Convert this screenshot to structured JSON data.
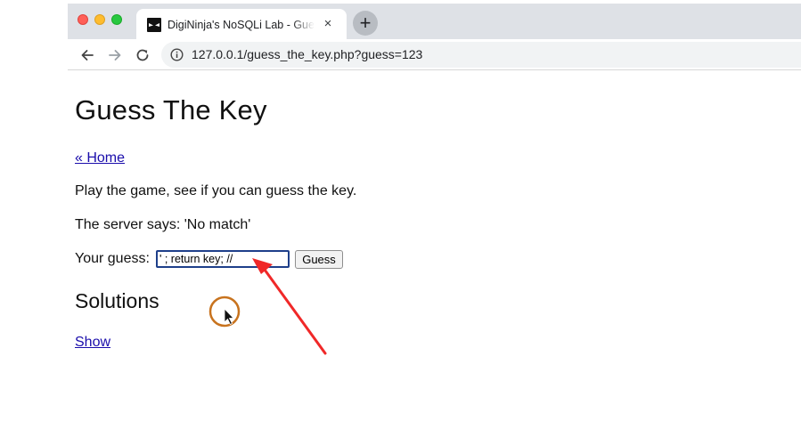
{
  "browser": {
    "tab": {
      "title": "DigiNinja's NoSQLi Lab - Guess the Key",
      "favicon": "ninja-favicon-icon",
      "close_symbol": "×"
    },
    "new_tab_symbol": "+",
    "toolbar": {
      "back_icon": "arrow-left-icon",
      "forward_icon": "arrow-right-icon",
      "reload_icon": "reload-icon",
      "url": "127.0.0.1/guess_the_key.php?guess=123"
    },
    "window_controls": {
      "close_color": "#ff5f57",
      "minimize_color": "#febc2e",
      "maximize_color": "#28c840"
    }
  },
  "page": {
    "title": "Guess The Key",
    "home_link": "« Home",
    "intro": "Play the game, see if you can guess the key.",
    "server_message": "The server says: 'No match'",
    "guess_label": "Your guess:",
    "guess_value": "' ; return key; //",
    "guess_button": "Guess",
    "solutions_heading": "Solutions",
    "show_link": "Show"
  },
  "annotations": {
    "arrow_color": "#f02828",
    "cursor_ring_color": "#c8731e"
  }
}
